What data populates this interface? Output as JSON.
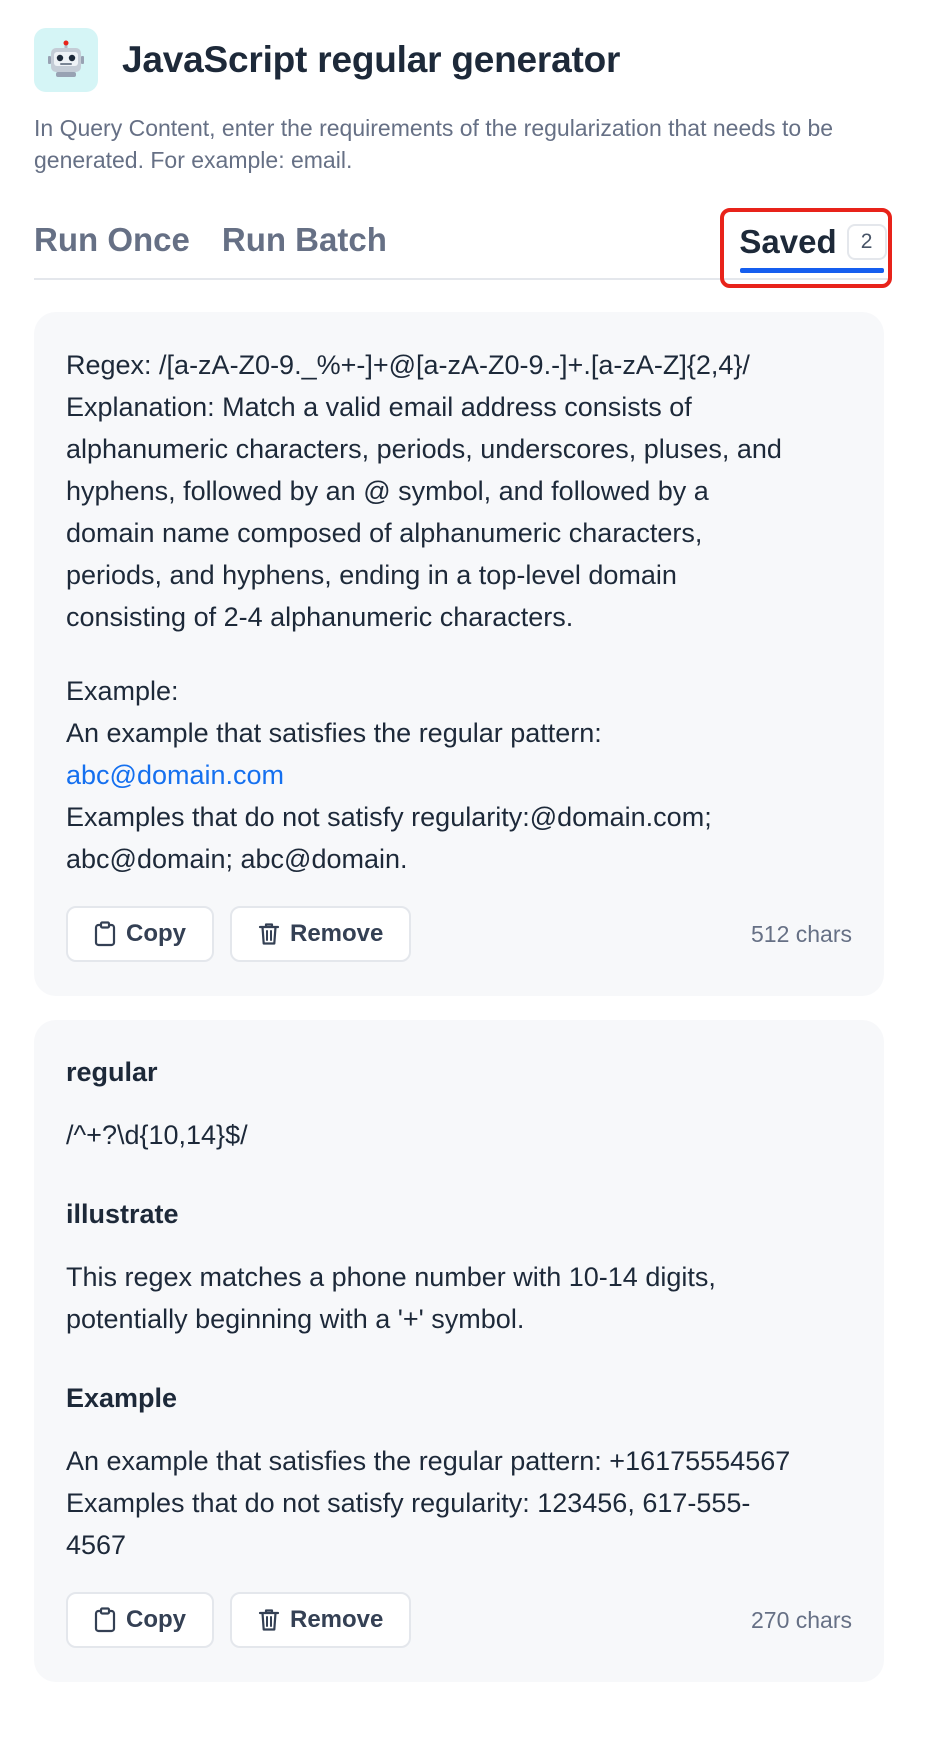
{
  "app": {
    "icon": "robot-emoji",
    "title": "JavaScript regular generator",
    "description": "In Query Content, enter the requirements of the regularization that needs to be generated. For example: email."
  },
  "tabs": {
    "run_once": "Run Once",
    "run_batch": "Run Batch",
    "saved": "Saved",
    "saved_count": "2"
  },
  "card1": {
    "p1": [
      "Regex: /[a-zA-Z0-9._%+-]+@[a-zA-Z0-9.-]+.[a-zA-Z]{2,4}/",
      "Explanation: Match a valid email address consists of",
      "alphanumeric characters, periods, underscores, pluses, and",
      "hyphens, followed by an @ symbol, and followed by a",
      "domain name composed of alphanumeric characters,",
      "periods, and hyphens, ending in a top-level domain",
      "consisting of 2-4 alphanumeric characters."
    ],
    "example_label": "Example:",
    "example_line": "An example that satisfies the regular pattern:",
    "example_link": "abc@domain.com",
    "bad_line1": "Examples that do not satisfy regularity:@domain.com;",
    "bad_line2": "abc@domain; abc@domain.",
    "copy_label": "Copy",
    "remove_label": "Remove",
    "chars": "512 chars"
  },
  "card2": {
    "h_regular": "regular",
    "regex": "/^+?\\d{10,14}$/",
    "h_illustrate": "illustrate",
    "illustrate_l1": "This regex matches a phone number with 10-14 digits,",
    "illustrate_l2": "potentially beginning with a '+' symbol.",
    "h_example": "Example",
    "ex_l1": "An example that satisfies the regular pattern: +16175554567",
    "ex_l2": "Examples that do not satisfy regularity: 123456, 617-555-",
    "ex_l3": "4567",
    "copy_label": "Copy",
    "remove_label": "Remove",
    "chars": "270 chars"
  },
  "colors": {
    "accent": "#155eef",
    "highlight_box": "#e8231a",
    "link": "#1570ef",
    "card_bg": "#f7f8fa",
    "icon_bg": "#d5f5f6"
  }
}
